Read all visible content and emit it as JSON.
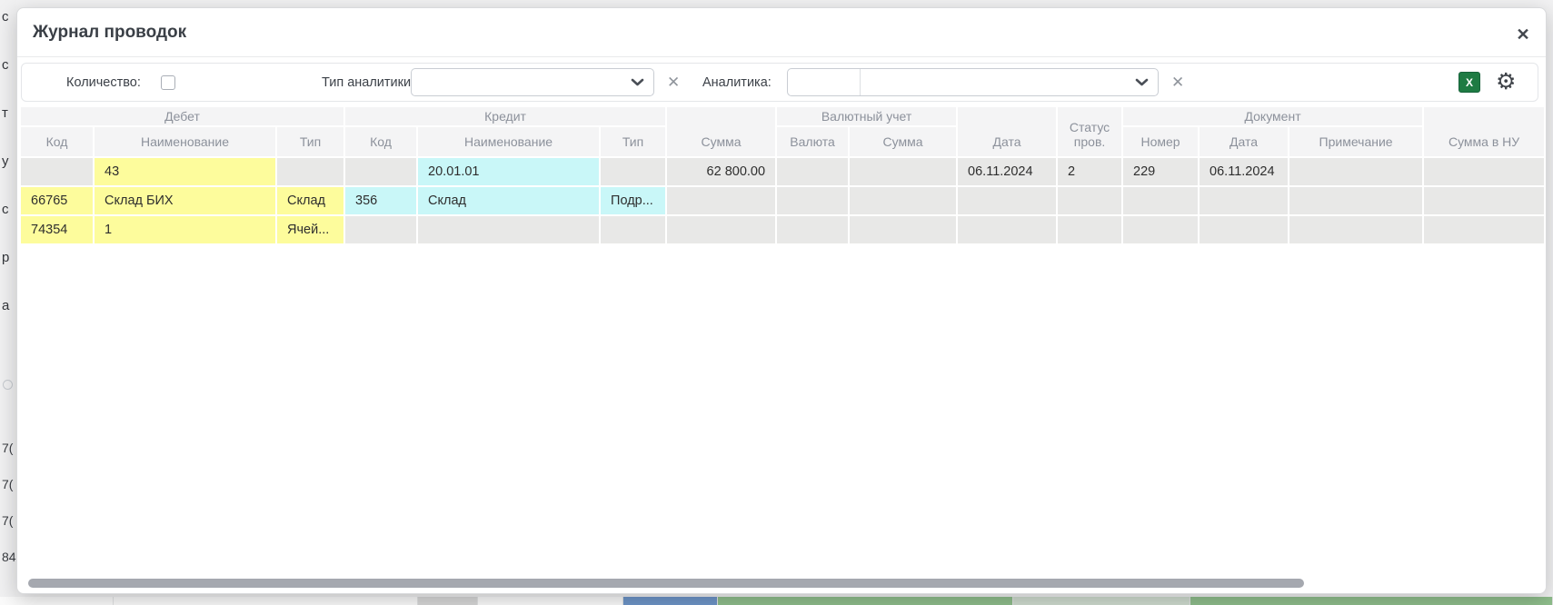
{
  "dialog": {
    "title": "Журнал проводок"
  },
  "icons": {
    "close": "✕",
    "clear": "✕",
    "gear": "⚙",
    "excel": "X"
  },
  "filters": {
    "quantity_label": "Количество:",
    "quantity_checked": false,
    "analytics_type_label": "Тип аналитики:",
    "analytics_type_value": "",
    "analytics_label": "Аналитика:",
    "analytics_code_value": "",
    "analytics_value": ""
  },
  "table": {
    "groups": {
      "debit": "Дебет",
      "credit": "Кредит",
      "currency": "Валютный учет",
      "document": "Документ"
    },
    "columns": {
      "debit_code": "Код",
      "debit_name": "Наименование",
      "debit_type": "Тип",
      "credit_code": "Код",
      "credit_name": "Наименование",
      "credit_type": "Тип",
      "amount": "Сумма",
      "currency": "Валюта",
      "currency_amount": "Сумма",
      "date": "Дата",
      "status": "Статус пров.",
      "doc_number": "Номер",
      "doc_date": "Дата",
      "note": "Примечание",
      "tax_amount": "Сумма в НУ"
    },
    "rows": [
      {
        "debit_code": "",
        "debit_name": "43",
        "debit_type": "",
        "credit_code": "",
        "credit_name": "20.01.01",
        "credit_type": "",
        "amount": "62 800.00",
        "currency": "",
        "currency_amount": "",
        "date": "06.11.2024",
        "status": "2",
        "doc_number": "229",
        "doc_date": "06.11.2024",
        "note": "",
        "tax_amount": ""
      },
      {
        "debit_code": "66765",
        "debit_name": "Склад БИХ",
        "debit_type": "Склад",
        "credit_code": "356",
        "credit_name": "Склад",
        "credit_type": "Подр...",
        "amount": "",
        "currency": "",
        "currency_amount": "",
        "date": "",
        "status": "",
        "doc_number": "",
        "doc_date": "",
        "note": "",
        "tax_amount": ""
      },
      {
        "debit_code": "74354",
        "debit_name": "1",
        "debit_type": "Ячей...",
        "credit_code": "",
        "credit_name": "",
        "credit_type": "",
        "amount": "",
        "currency": "",
        "currency_amount": "",
        "date": "",
        "status": "",
        "doc_number": "",
        "doc_date": "",
        "note": "",
        "tax_amount": ""
      }
    ]
  },
  "background": {
    "fragments": [
      "с",
      "с",
      "т",
      "у",
      "с",
      "р",
      "а",
      "7(",
      "7(",
      "7(",
      "84"
    ]
  },
  "colors": {
    "highlight_debit": "#fdfc9c",
    "highlight_credit": "#c9f7f8",
    "excel_green": "#1e7b43",
    "row_gray": "#e8e8e7",
    "strip_blue": "#6e95c8",
    "strip_green": "#8fbe8c",
    "strip_pale": "#cfdccf",
    "strip_gray": "#d8d8d8"
  }
}
